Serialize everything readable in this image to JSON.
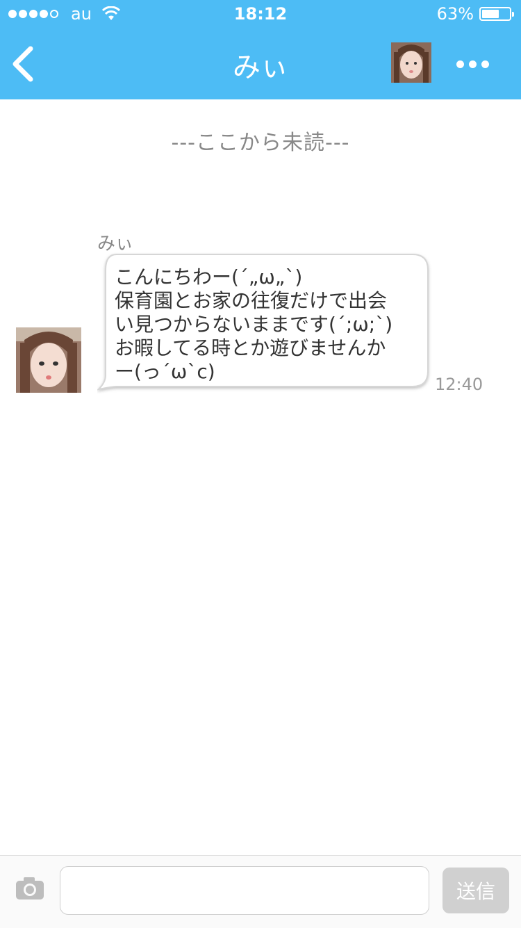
{
  "status_bar": {
    "carrier": "au",
    "time": "18:12",
    "battery_percent": "63%",
    "battery_level": 0.63,
    "signal_bars_filled": 4,
    "signal_bars_total": 5
  },
  "header": {
    "title": "みぃ",
    "background_color": "#4dbcf5",
    "back_icon": "chevron-left-icon",
    "more_icon": "ellipsis-icon"
  },
  "chat": {
    "unread_divider": "---ここから未読---",
    "messages": [
      {
        "sender": "みぃ",
        "text": "こんにちわー(´„ω„`)\n保育園とお家の往復だけで出会\nい見つからないままです(´;ω;`)\nお暇してる時とか遊びませんか\nー(っ´ω`c)",
        "time": "12:40"
      }
    ]
  },
  "composer": {
    "camera_icon": "camera-icon",
    "input_value": "",
    "input_placeholder": "",
    "send_label": "送信"
  }
}
